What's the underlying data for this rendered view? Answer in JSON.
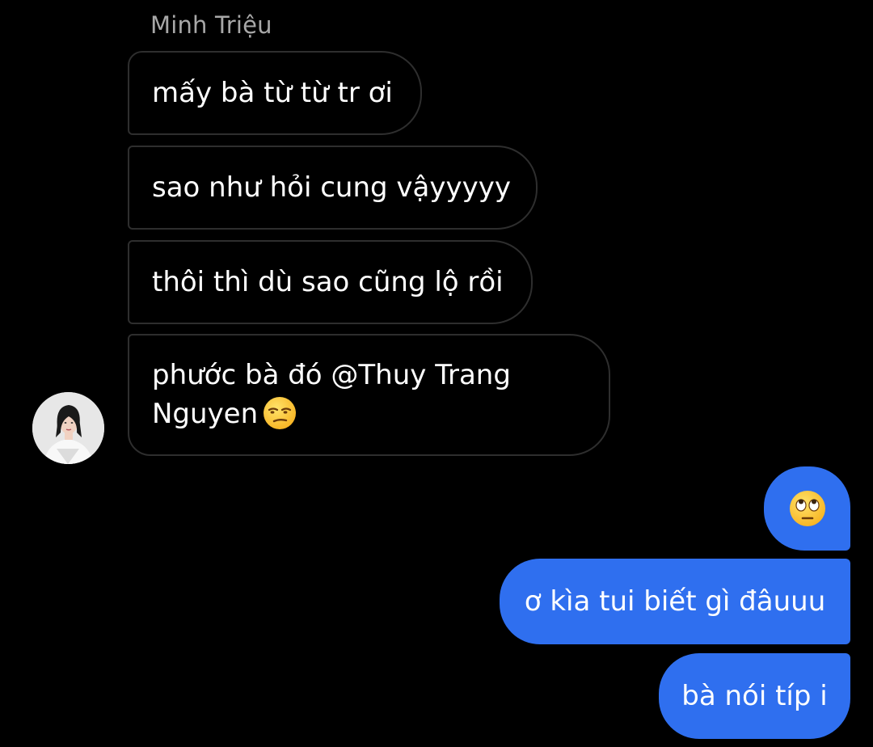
{
  "conversation": {
    "sender_name": "Minh Triệu",
    "incoming": [
      {
        "text": "mấy bà từ từ tr ơi"
      },
      {
        "text": "sao như hỏi cung vậyyyyy"
      },
      {
        "text": "thôi thì dù sao cũng lộ rồi"
      },
      {
        "text": "phước bà đó @Thuy Trang Nguyen",
        "emoji": "unamused-face-emoji"
      }
    ],
    "outgoing": [
      {
        "emoji": "face-with-rolling-eyes-emoji"
      },
      {
        "text": "ơ kìa tui biết gì đâuuu"
      },
      {
        "text": "bà nói típ i"
      }
    ],
    "avatar": "sender-avatar-photo"
  },
  "colors": {
    "background": "#000000",
    "incoming_border": "#2e2e2e",
    "outgoing_bubble": "#2f6fef",
    "sender_name": "#a8a8a8",
    "text": "#ffffff"
  }
}
